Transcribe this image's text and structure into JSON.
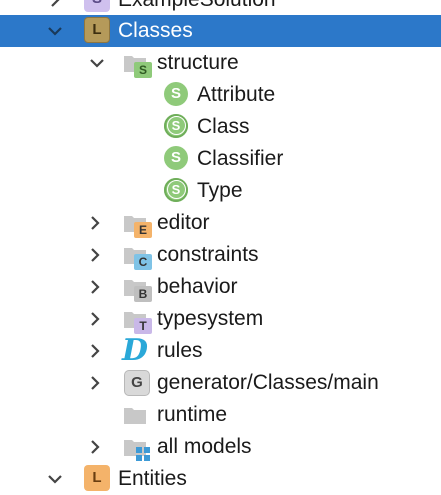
{
  "tree": {
    "top_partial": {
      "label": "ExampleSolution",
      "icon": "solution-icon",
      "badge": "S"
    },
    "classes": {
      "label": "Classes",
      "icon": "language-icon",
      "badge": "L"
    },
    "structure": {
      "label": "structure",
      "badge": "S"
    },
    "concepts": [
      {
        "label": "Attribute",
        "badge": "S"
      },
      {
        "label": "Class",
        "badge": "S"
      },
      {
        "label": "Classifier",
        "badge": "S"
      },
      {
        "label": "Type",
        "badge": "S"
      }
    ],
    "aspects": [
      {
        "label": "editor",
        "badge": "E",
        "color": "#f4b36a"
      },
      {
        "label": "constraints",
        "badge": "C",
        "color": "#7fc3e6"
      },
      {
        "label": "behavior",
        "badge": "B",
        "color": "#bfbfbf"
      },
      {
        "label": "typesystem",
        "badge": "T",
        "color": "#c9b8e8"
      }
    ],
    "rules": {
      "label": "rules",
      "badge": "D"
    },
    "generator": {
      "label": "generator/Classes/main",
      "badge": "G"
    },
    "runtime": {
      "label": "runtime"
    },
    "all_models": {
      "label": "all models"
    },
    "entities": {
      "label": "Entities",
      "badge": "L"
    }
  },
  "colors": {
    "selection": "#2c78c9",
    "concept": "#8fca7a",
    "folder": "#c8c8c8"
  }
}
